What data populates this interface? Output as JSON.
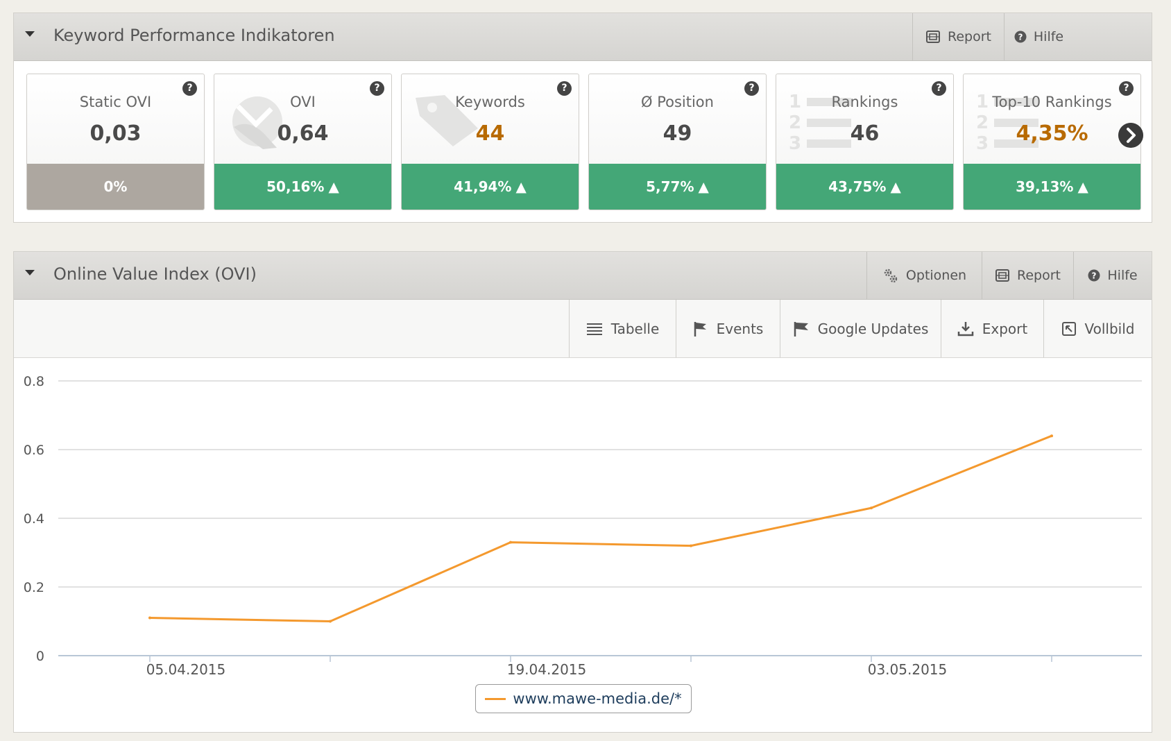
{
  "kpi_panel": {
    "title": "Keyword Performance Indikatoren",
    "report_label": "Report",
    "help_label": "Hilfe",
    "help_mark": "?",
    "tiles": [
      {
        "label": "Static OVI",
        "value": "0,03",
        "change": "0%",
        "trend": "",
        "status": "neutral",
        "icon": "none"
      },
      {
        "label": "OVI",
        "value": "0,64",
        "change": "50,16%",
        "trend": "▲",
        "status": "up",
        "icon": "ovi-icon"
      },
      {
        "label": "Keywords",
        "value": "44",
        "change": "41,94%",
        "trend": "▲",
        "status": "up",
        "icon": "tag-icon",
        "value_color": "#b86a00"
      },
      {
        "label": "Ø Position",
        "value": "49",
        "change": "5,77%",
        "trend": "▲",
        "status": "up",
        "icon": "none"
      },
      {
        "label": "Rankings",
        "value": "46",
        "change": "43,75%",
        "trend": "▲",
        "status": "up",
        "icon": "ranking-list-icon"
      },
      {
        "label": "Top-10 Rankings",
        "value": "4,35%",
        "change": "39,13%",
        "trend": "▲",
        "status": "up",
        "icon": "ranking-list-icon",
        "value_color": "#b86a00"
      }
    ]
  },
  "ovi_panel": {
    "title": "Online Value Index (OVI)",
    "options_label": "Optionen",
    "report_label": "Report",
    "help_label": "Hilfe",
    "toolbar": {
      "table_label": "Tabelle",
      "events_label": "Events",
      "google_updates_label": "Google Updates",
      "export_label": "Export",
      "fullscreen_label": "Vollbild"
    }
  },
  "colors": {
    "series_line": "#f4992e",
    "positive": "#44a777",
    "neutral": "#ada7a0",
    "highlight_value": "#b86a00"
  },
  "chart_data": {
    "type": "line",
    "y_ticks": [
      "0",
      "0.2",
      "0.4",
      "0.6",
      "0.8"
    ],
    "ylim": [
      0,
      0.8
    ],
    "x_tick_labels": [
      {
        "date": "2015-04-05",
        "label": "05.04.2015"
      },
      {
        "date": "2015-04-19",
        "label": "19.04.2015"
      },
      {
        "date": "2015-05-03",
        "label": "03.05.2015"
      }
    ],
    "x_range": [
      "2015-04-05",
      "2015-05-17"
    ],
    "grid": true,
    "legend_position": "bottom-center",
    "series": [
      {
        "name": "www.mawe-media.de/*",
        "color": "#f4992e",
        "points": [
          {
            "x": "2015-04-05",
            "y": 0.11
          },
          {
            "x": "2015-04-12",
            "y": 0.1
          },
          {
            "x": "2015-04-19",
            "y": 0.33
          },
          {
            "x": "2015-04-26",
            "y": 0.32
          },
          {
            "x": "2015-05-03",
            "y": 0.43
          },
          {
            "x": "2015-05-10",
            "y": 0.64
          }
        ]
      }
    ]
  }
}
